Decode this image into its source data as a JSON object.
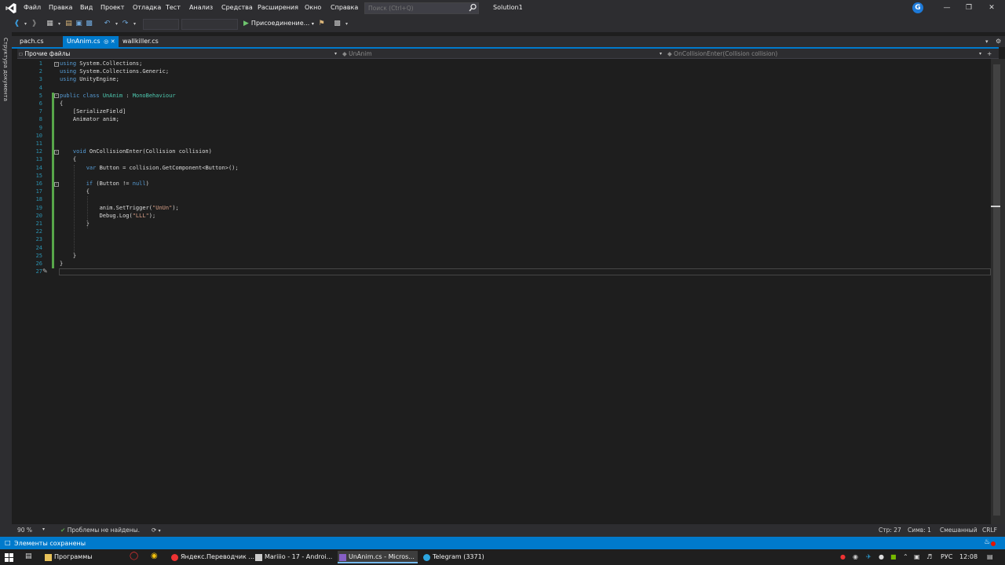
{
  "menu": {
    "items": [
      "Файл",
      "Правка",
      "Вид",
      "Проект",
      "Отладка",
      "Тест",
      "Анализ",
      "Средства",
      "Расширения",
      "Окно",
      "Справка"
    ],
    "search_placeholder": "Поиск (Ctrl+Q)",
    "solution_name": "Solution1",
    "account_initial": "G"
  },
  "toolbar": {
    "attach_label": "Присоединение..."
  },
  "left_panel": {
    "document_outline": "Структура документа"
  },
  "tabs": [
    {
      "label": "pach.cs",
      "active": false
    },
    {
      "label": "UnAnim.cs",
      "active": true
    },
    {
      "label": "wallkiller.cs",
      "active": false
    }
  ],
  "navbar": {
    "project": "Прочие файлы",
    "class": "UnAnim",
    "member": "OnCollisionEnter(Collision collision)"
  },
  "editor": {
    "lines": [
      "using System.Collections;",
      "using System.Collections.Generic;",
      "using UnityEngine;",
      "",
      "public class UnAnim : MonoBehaviour",
      "{",
      "    [SerializeField]",
      "    Animator anim;",
      "",
      "",
      "",
      "    void OnCollisionEnter(Collision collision)",
      "    {",
      "        var Button = collision.GetComponent<Button>();",
      "",
      "        if (Button != null)",
      "        {",
      "",
      "            anim.SetTrigger(\"UnUn\");",
      "            Debug.Log(\"LLL\");",
      "        }",
      "",
      "",
      "",
      "    }",
      "}",
      ""
    ]
  },
  "editor_status": {
    "zoom": "90 %",
    "problems": "Проблемы не найдены.",
    "line": "Стр: 27",
    "col": "Симв: 1",
    "encoding": "Смешанный",
    "eol": "CRLF"
  },
  "status": {
    "message": "Элементы сохранены"
  },
  "taskbar": {
    "items": [
      "Программы",
      "Яндекс.Переводчик ...",
      "Mariiio - 17 - Androi...",
      "UnAnim.cs - Micros...",
      "Telegram (3371)"
    ],
    "language": "РУС",
    "time": "12:08"
  },
  "colors": {
    "accent": "#007acc",
    "keyword": "#569cd6",
    "type": "#4ec9b0",
    "string": "#d69d85",
    "line_number": "#2b91af"
  }
}
